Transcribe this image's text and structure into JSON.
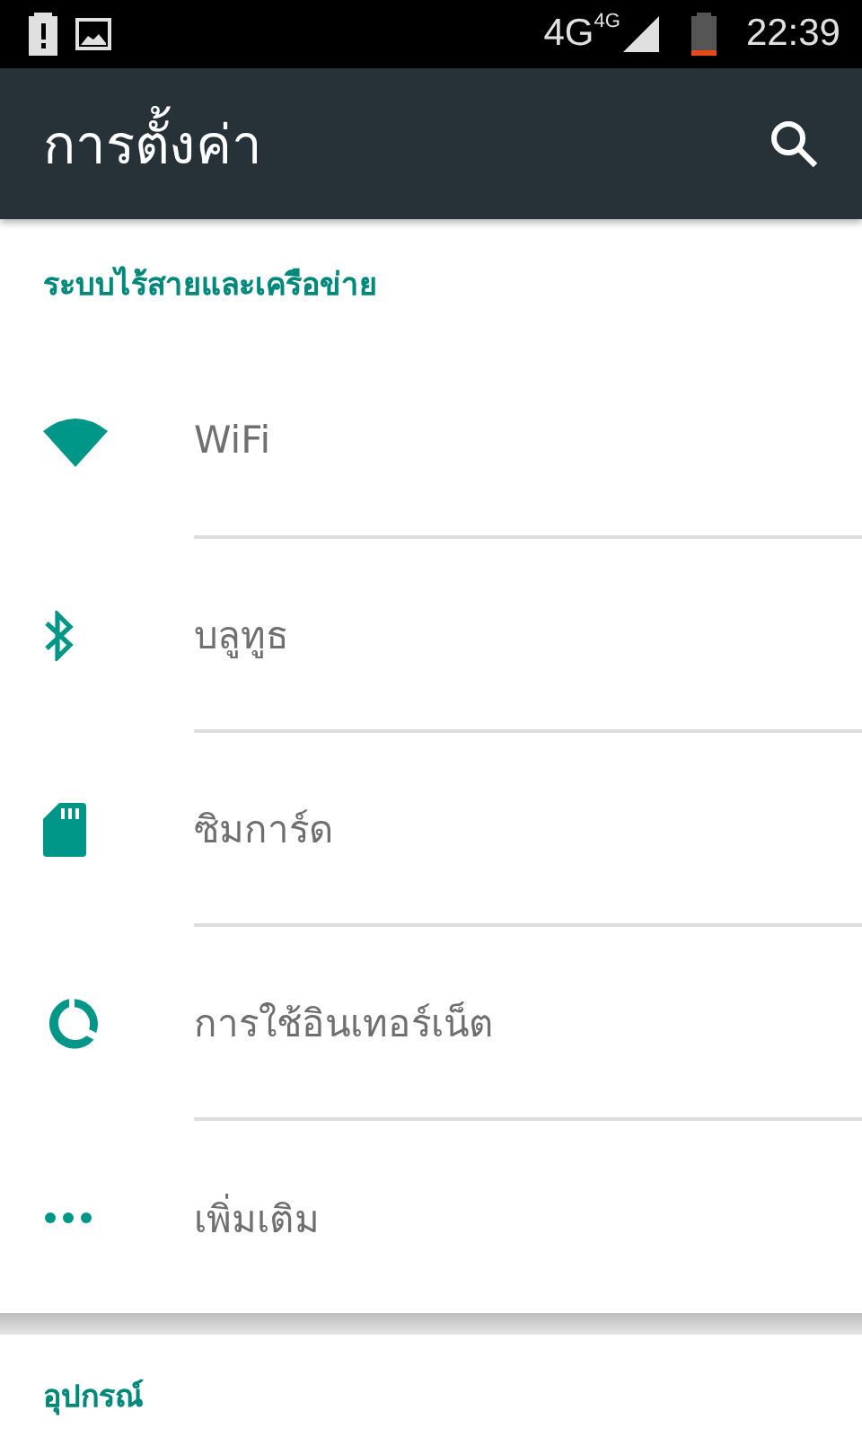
{
  "status_bar": {
    "network": "4G",
    "network_small": "4G",
    "time": "22:39"
  },
  "app_bar": {
    "title": "การตั้งค่า"
  },
  "sections": [
    {
      "header": "ระบบไร้สายและเครือข่าย",
      "items": [
        {
          "kind": "wifi",
          "label": "WiFi"
        },
        {
          "kind": "bluetooth",
          "label": "บลูทูธ"
        },
        {
          "kind": "sim",
          "label": "ซิมการ์ด"
        },
        {
          "kind": "data",
          "label": "การใช้อินเทอร์เน็ต"
        },
        {
          "kind": "more",
          "label": "เพิ่มเติม"
        }
      ]
    },
    {
      "header": "อุปกรณ์"
    }
  ]
}
